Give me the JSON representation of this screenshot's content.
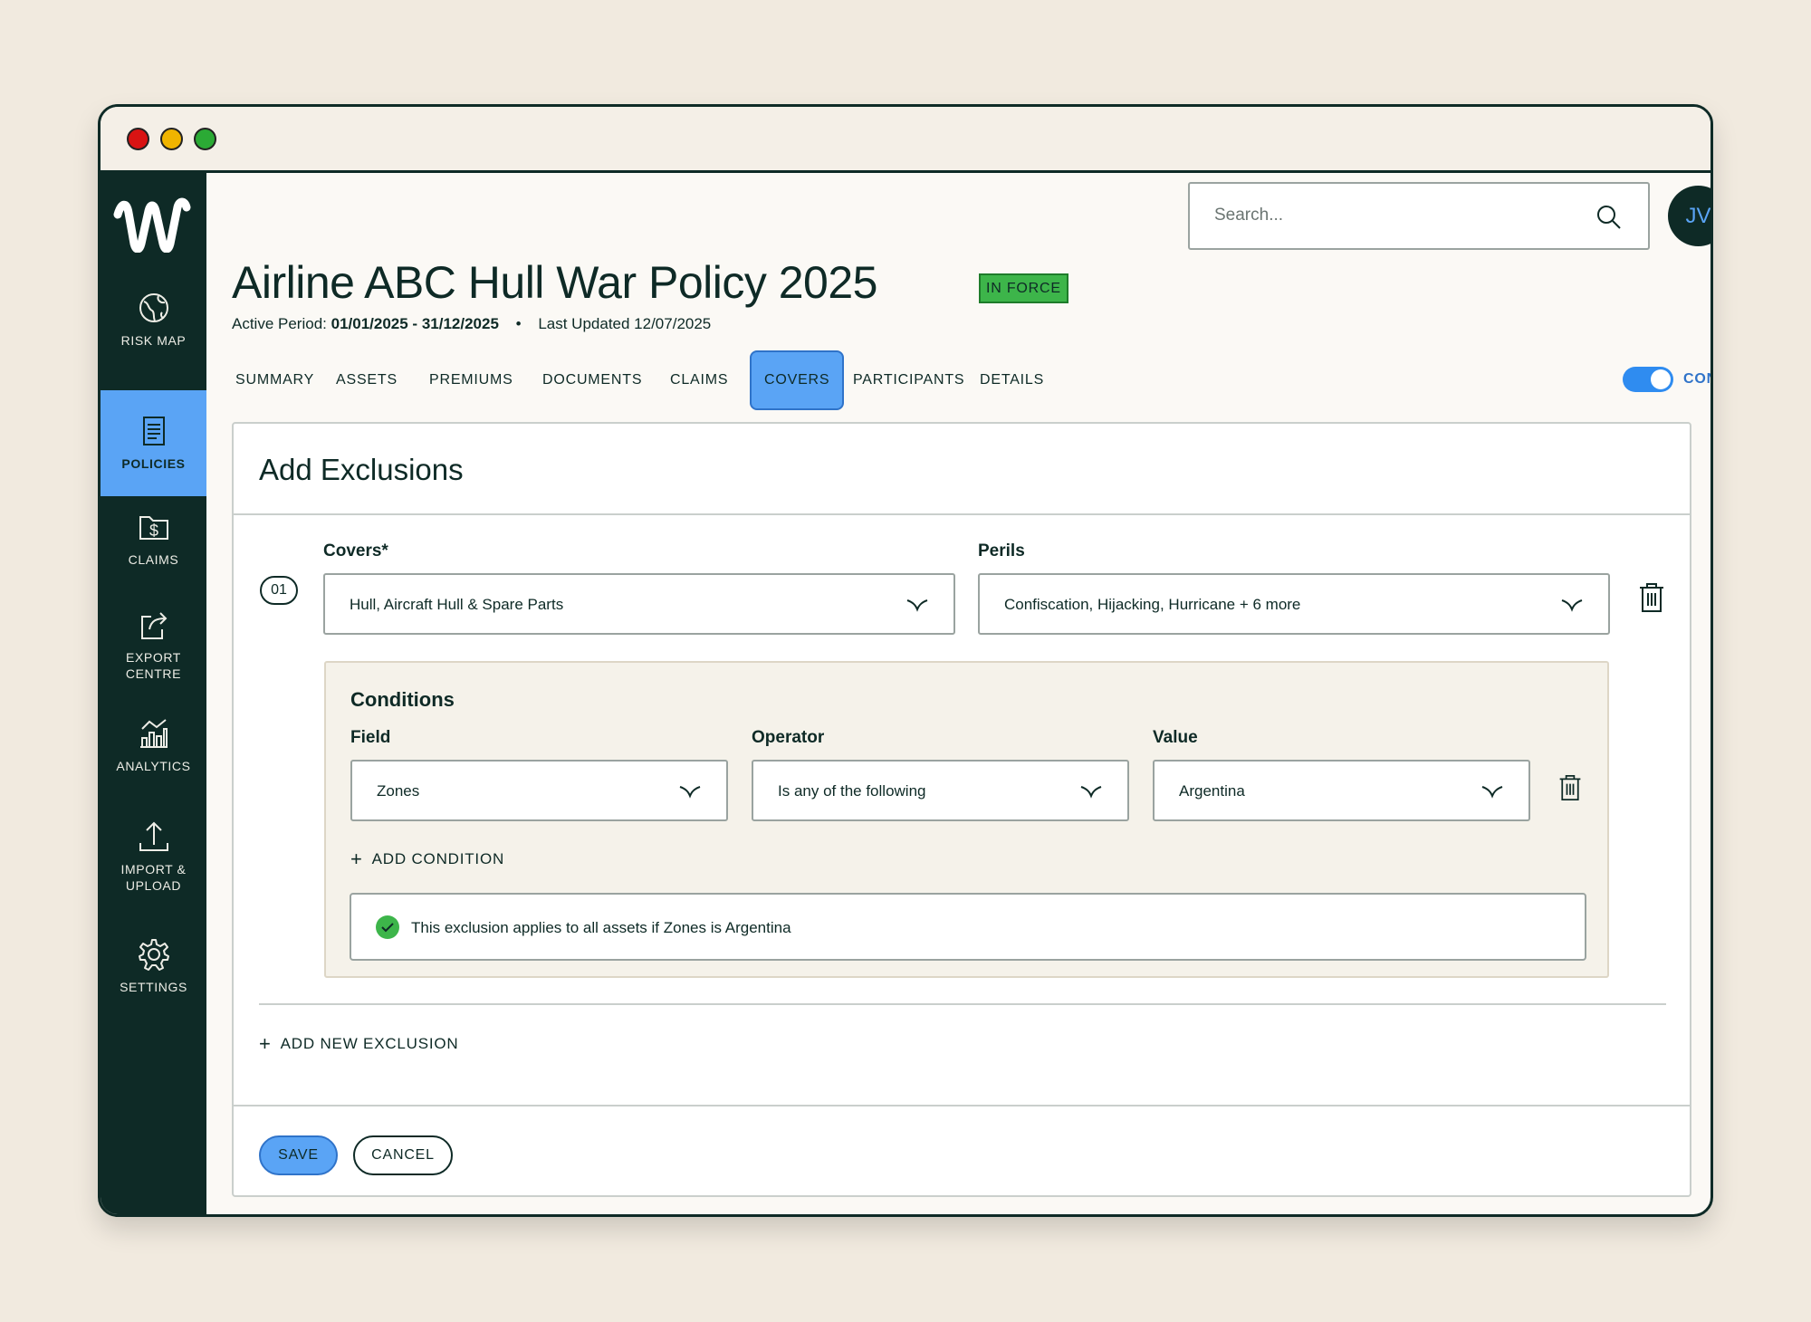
{
  "window": {
    "controls": [
      "close",
      "minimize",
      "maximize"
    ]
  },
  "sidebar": {
    "logo": "W",
    "items": [
      {
        "label": "RISK MAP",
        "icon": "globe-icon"
      },
      {
        "label": "POLICIES",
        "icon": "document-icon",
        "active": true
      },
      {
        "label": "CLAIMS",
        "icon": "folder-dollar-icon"
      },
      {
        "label": "EXPORT CENTRE",
        "icon": "export-icon"
      },
      {
        "label": "ANALYTICS",
        "icon": "analytics-icon"
      },
      {
        "label": "IMPORT & UPLOAD",
        "icon": "upload-icon"
      },
      {
        "label": "SETTINGS",
        "icon": "gear-icon"
      }
    ]
  },
  "header": {
    "search_placeholder": "Search...",
    "avatar_initials": "JV"
  },
  "policy": {
    "title": "Airline ABC Hull War Policy 2025",
    "status": "IN FORCE",
    "active_period_label": "Active Period:",
    "active_period_value": "01/01/2025 - 31/12/2025",
    "separator": "•",
    "last_updated": "Last Updated 12/07/2025"
  },
  "tabs": [
    "SUMMARY",
    "ASSETS",
    "PREMIUMS",
    "DOCUMENTS",
    "CLAIMS",
    "COVERS",
    "PARTICIPANTS",
    "DETAILS"
  ],
  "active_tab": "COVERS",
  "config_mode": {
    "label": "CONFIG MODE",
    "enabled": true
  },
  "exclusions": {
    "title": "Add Exclusions",
    "number": "01",
    "covers_label": "Covers*",
    "covers_value": "Hull, Aircraft Hull & Spare Parts",
    "perils_label": "Perils",
    "perils_value": "Confiscation, Hijacking, Hurricane + 6 more",
    "conditions": {
      "title": "Conditions",
      "field_label": "Field",
      "field_value": "Zones",
      "operator_label": "Operator",
      "operator_value": "Is any of the following",
      "value_label": "Value",
      "value_value": "Argentina",
      "add_condition": "ADD CONDITION",
      "summary": "This exclusion applies to all assets if Zones is Argentina"
    },
    "add_new_exclusion": "ADD NEW EXCLUSION",
    "save": "SAVE",
    "cancel": "CANCEL"
  },
  "colors": {
    "sidebar_bg": "#0E2A26",
    "accent_blue": "#5AA4F5",
    "status_green": "#3DB54A",
    "page_bg": "#F1EADF"
  }
}
